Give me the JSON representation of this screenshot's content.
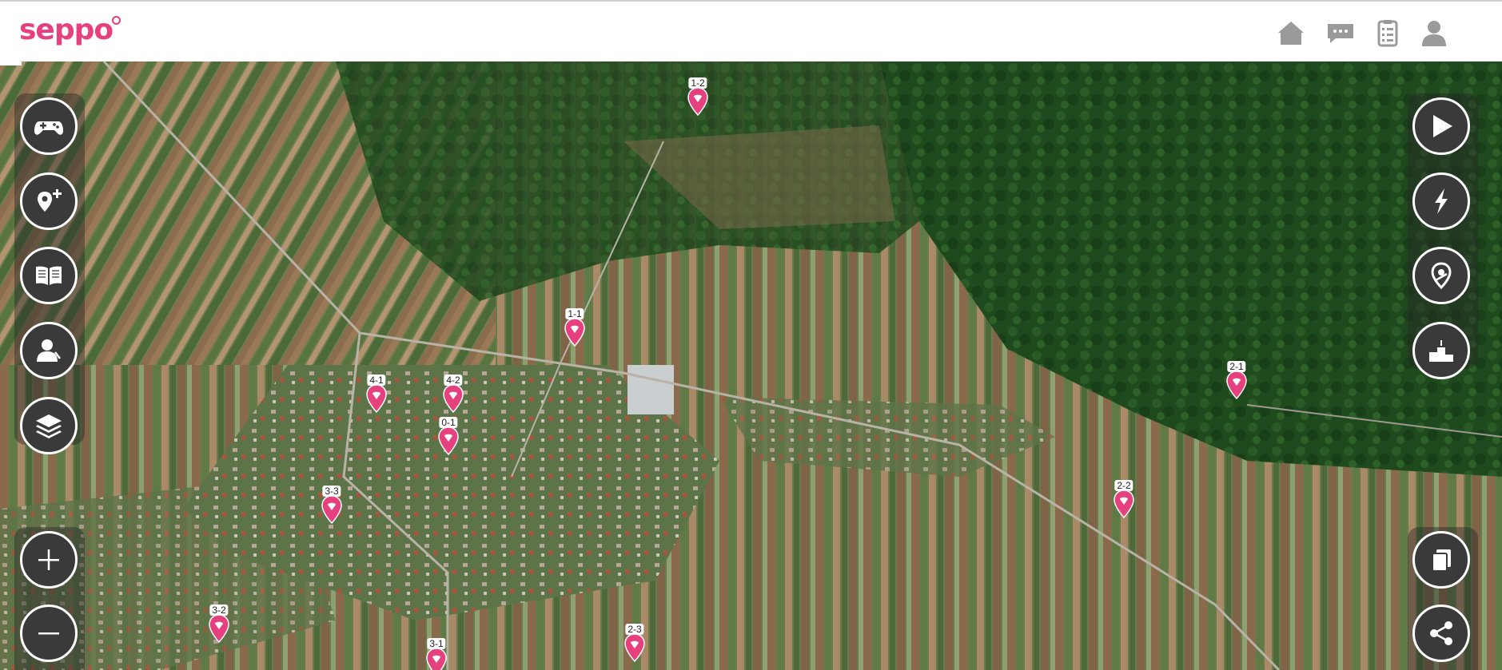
{
  "app": {
    "logo_text": "seppo",
    "brand_color": "#e6407f"
  },
  "header": {
    "nav": [
      {
        "name": "home-icon"
      },
      {
        "name": "chat-icon"
      },
      {
        "name": "clipboard-list-icon"
      },
      {
        "name": "user-icon"
      }
    ]
  },
  "map": {
    "left_controls": [
      {
        "name": "gamepad-icon"
      },
      {
        "name": "add-location-icon"
      },
      {
        "name": "open-book-icon"
      },
      {
        "name": "person-icon"
      },
      {
        "name": "layers-icon"
      }
    ],
    "zoom_controls": [
      {
        "name": "plus-icon"
      },
      {
        "name": "minus-icon"
      }
    ],
    "right_controls": [
      {
        "name": "play-icon"
      },
      {
        "name": "lightning-icon"
      },
      {
        "name": "location-route-icon"
      },
      {
        "name": "podium-icon"
      }
    ],
    "bottom_right_controls": [
      {
        "name": "cards-icon"
      },
      {
        "name": "share-icon"
      }
    ],
    "pins": [
      {
        "label": "1-2"
      },
      {
        "label": "1-1"
      },
      {
        "label": "4-1"
      },
      {
        "label": "4-2"
      },
      {
        "label": "0-1"
      },
      {
        "label": "3-3"
      },
      {
        "label": "2-1"
      },
      {
        "label": "2-2"
      },
      {
        "label": "3-2"
      },
      {
        "label": "3-1"
      },
      {
        "label": "2-3"
      }
    ]
  }
}
